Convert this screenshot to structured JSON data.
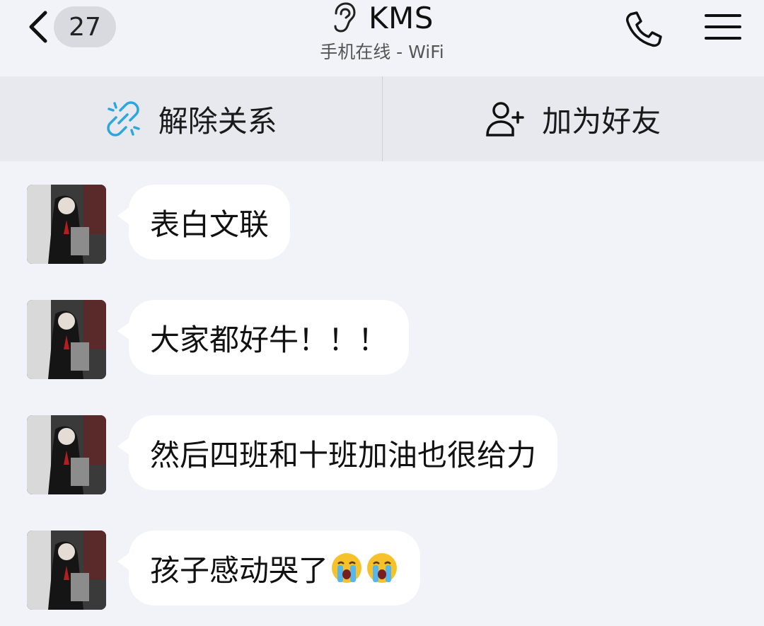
{
  "header": {
    "back_count": "27",
    "title": "KMS",
    "status": "手机在线 - WiFi"
  },
  "actions": {
    "unlink_label": "解除关系",
    "add_friend_label": "加为好友"
  },
  "messages": [
    {
      "text": "表白文联"
    },
    {
      "text": "大家都好牛！！！"
    },
    {
      "text": "然后四班和十班加油也很给力"
    },
    {
      "text": "孩子感动哭了",
      "emoji": [
        "crying-face-icon",
        "crying-face-icon"
      ]
    }
  ],
  "colors": {
    "background": "#f2f3f8",
    "action_bar": "#e8e9ee",
    "bubble": "#ffffff",
    "link_icon": "#2ba6e0"
  }
}
